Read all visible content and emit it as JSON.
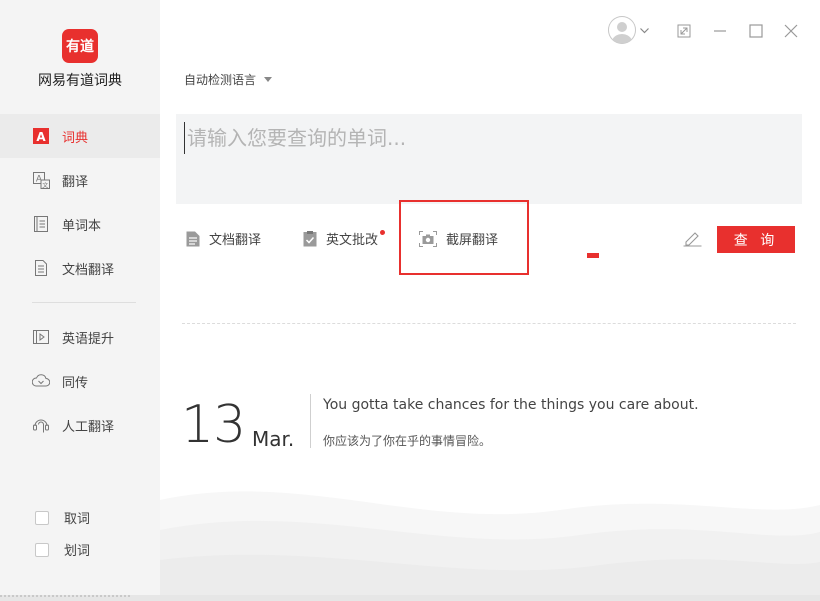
{
  "app": {
    "logo_text": "有道",
    "name": "网易有道词典"
  },
  "sidebar": {
    "items": [
      {
        "label": "词典",
        "icon": "dictionary-icon",
        "active": true
      },
      {
        "label": "翻译",
        "icon": "translate-icon"
      },
      {
        "label": "单词本",
        "icon": "wordbook-icon"
      },
      {
        "label": "文档翻译",
        "icon": "document-translate-icon"
      },
      {
        "label": "英语提升",
        "icon": "english-improve-icon"
      },
      {
        "label": "同传",
        "icon": "simultaneous-interpret-icon"
      },
      {
        "label": "人工翻译",
        "icon": "human-translate-icon"
      }
    ],
    "checks": [
      {
        "label": "取词",
        "checked": false
      },
      {
        "label": "划词",
        "checked": false
      }
    ]
  },
  "main": {
    "language_select": "自动检测语言",
    "search_placeholder": "请输入您要查询的单词...",
    "tools": [
      {
        "label": "文档翻译",
        "icon": "document-icon"
      },
      {
        "label": "英文批改",
        "icon": "correction-icon",
        "has_badge": true
      },
      {
        "label": "截屏翻译",
        "icon": "screenshot-icon"
      }
    ],
    "query_button": "查 询"
  },
  "daily": {
    "day": "13",
    "month": "Mar.",
    "quote_en": "You gotta take chances for the things you care about.",
    "quote_cn": "你应该为了你在乎的事情冒险。"
  },
  "colors": {
    "accent": "#e8302e",
    "sidebar_bg": "#f4f4f4",
    "search_bg": "#f3f4f5"
  }
}
